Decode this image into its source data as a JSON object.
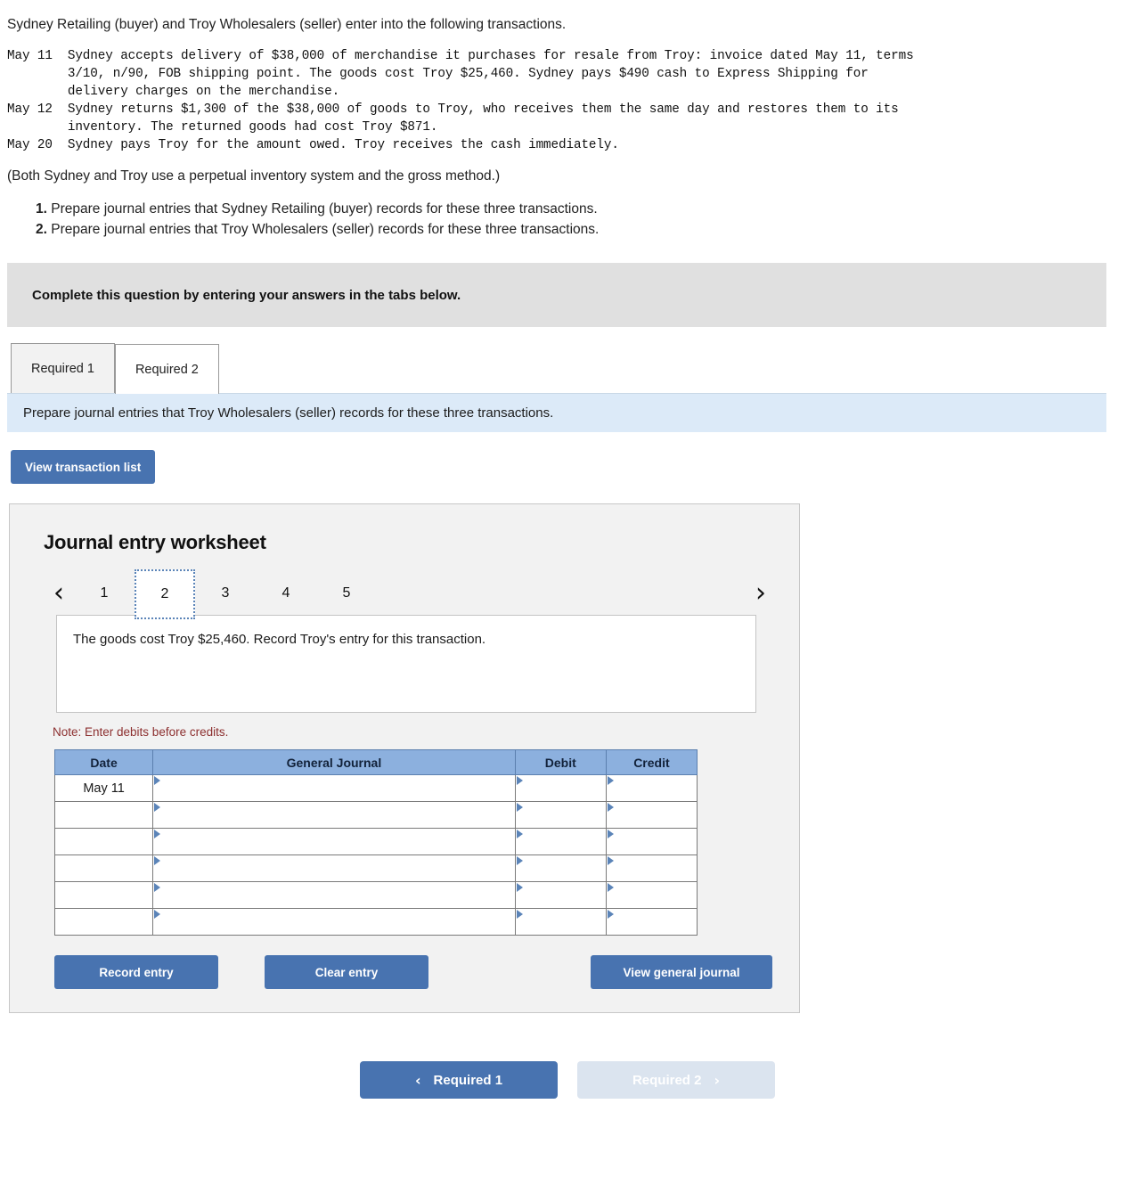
{
  "intro": {
    "lead": "Sydney Retailing (buyer) and Troy Wholesalers (seller) enter into the following transactions.",
    "transactions_text": "May 11  Sydney accepts delivery of $38,000 of merchandise it purchases for resale from Troy: invoice dated May 11, terms\n        3/10, n/90, FOB shipping point. The goods cost Troy $25,460. Sydney pays $490 cash to Express Shipping for\n        delivery charges on the merchandise.\nMay 12  Sydney returns $1,300 of the $38,000 of goods to Troy, who receives them the same day and restores them to its\n        inventory. The returned goods had cost Troy $871.\nMay 20  Sydney pays Troy for the amount owed. Troy receives the cash immediately.",
    "method_note": "(Both Sydney and Troy use a perpetual inventory system and the gross method.)",
    "requirements": [
      {
        "num": "1.",
        "text": "Prepare journal entries that Sydney Retailing (buyer) records for these three transactions."
      },
      {
        "num": "2.",
        "text": "Prepare journal entries that Troy Wholesalers (seller) records for these three transactions."
      }
    ]
  },
  "banner": {
    "text": "Complete this question by entering your answers in the tabs below."
  },
  "tabs": {
    "items": [
      {
        "label": "Required 1",
        "active": false
      },
      {
        "label": "Required 2",
        "active": true
      }
    ],
    "instruction": "Prepare journal entries that Troy Wholesalers (seller) records for these three transactions."
  },
  "toolbar": {
    "view_transaction_list": "View transaction list"
  },
  "worksheet": {
    "title": "Journal entry worksheet",
    "pager": {
      "prev_icon": "chevron-left",
      "next_icon": "chevron-right",
      "pages": [
        "1",
        "2",
        "3",
        "4",
        "5"
      ],
      "active_page": "2"
    },
    "description": "The goods cost Troy $25,460. Record Troy's entry for this transaction.",
    "note": "Note: Enter debits before credits.",
    "table": {
      "headers": [
        "Date",
        "General Journal",
        "Debit",
        "Credit"
      ],
      "rows": [
        {
          "date": "May 11",
          "general_journal": "",
          "debit": "",
          "credit": ""
        },
        {
          "date": "",
          "general_journal": "",
          "debit": "",
          "credit": ""
        },
        {
          "date": "",
          "general_journal": "",
          "debit": "",
          "credit": ""
        },
        {
          "date": "",
          "general_journal": "",
          "debit": "",
          "credit": ""
        },
        {
          "date": "",
          "general_journal": "",
          "debit": "",
          "credit": ""
        },
        {
          "date": "",
          "general_journal": "",
          "debit": "",
          "credit": ""
        }
      ]
    },
    "actions": {
      "record_entry": "Record entry",
      "clear_entry": "Clear entry",
      "view_general_journal": "View general journal"
    }
  },
  "bottom_nav": {
    "prev_label": "Required 1",
    "next_label": "Required 2",
    "prev_chevron": "‹",
    "next_chevron": "›"
  },
  "colors": {
    "accent_blue": "#4873b0",
    "table_header_blue": "#8cb0de",
    "instruction_blue": "#dceaf8",
    "banner_gray": "#e0e0e0",
    "note_red": "#8c2f2f"
  }
}
